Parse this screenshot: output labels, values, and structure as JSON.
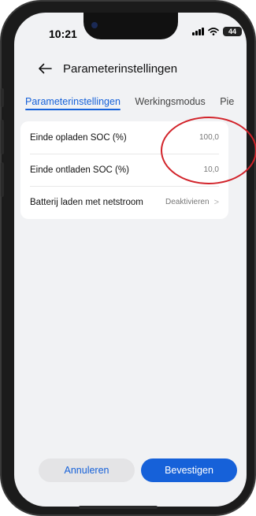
{
  "status_bar": {
    "time": "10:21",
    "battery": "44"
  },
  "header": {
    "title": "Parameterinstellingen"
  },
  "tabs": [
    {
      "label": "Parameterinstellingen",
      "active": true
    },
    {
      "label": "Werkingsmodus",
      "active": false
    },
    {
      "label": "Piek",
      "active": false
    }
  ],
  "settings": [
    {
      "label": "Einde opladen SOC (%)",
      "value": "100,0"
    },
    {
      "label": "Einde ontladen SOC (%)",
      "value": "10,0"
    },
    {
      "label": "Batterij laden met netstroom",
      "value": "Deaktivieren"
    }
  ],
  "buttons": {
    "cancel": "Annuleren",
    "confirm": "Bevestigen"
  },
  "colors": {
    "accent": "#1661d9",
    "annotation": "#d2232a",
    "background": "#f1f2f4"
  },
  "icons": {
    "back": "arrow-left-icon",
    "chevron": "chevron-right-icon"
  }
}
